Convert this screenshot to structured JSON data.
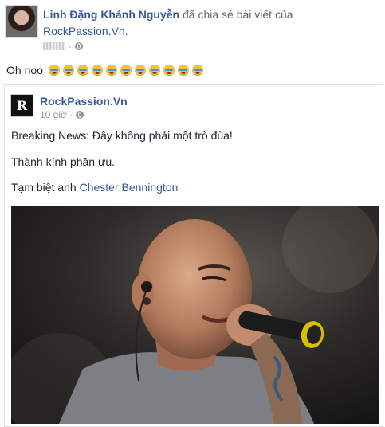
{
  "share_header": {
    "user_name": "Linh Đặng Khánh Nguyễn",
    "verb": "đã chia sẻ bài viết của",
    "shared_page": "RockPassion.Vn."
  },
  "post": {
    "text": "Oh noo",
    "emoji_count": 11,
    "emoji_icon": "crying-face-icon"
  },
  "shared_post": {
    "page_name": "RockPassion.Vn",
    "page_avatar_letter": "R",
    "time": "10 giờ ·",
    "line1": "Breaking News: Đây không phải một trò đùa!",
    "line2": "Thành kính phân ưu.",
    "line3_prefix": "Tạm biệt anh ",
    "line3_link": "Chester Bennington"
  },
  "colors": {
    "link": "#365899",
    "muted": "#90949c",
    "border": "#dddfe2"
  }
}
